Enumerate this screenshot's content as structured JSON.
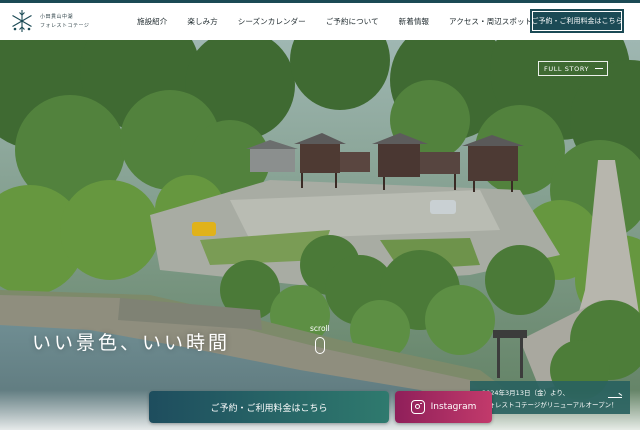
{
  "header": {
    "logo_line1": "小田貫山中湖",
    "logo_line2": "フォレストコテージ",
    "nav": [
      {
        "label": "施設紹介"
      },
      {
        "label": "楽しみ方"
      },
      {
        "label": "シーズンカレンダー"
      },
      {
        "label": "ご予約について"
      },
      {
        "label": "新着情報"
      },
      {
        "label": "アクセス・周辺スポット"
      }
    ],
    "cta_label": "ご予約・ご利用料金はこちら"
  },
  "hero": {
    "full_story_label": "FULL STORY",
    "catchcopy": "いい景色、いい時間",
    "scroll_label": "scroll"
  },
  "news": {
    "line1": "2024年3月13日（金）より、",
    "line2": "フォレストコテージがリニューアルオープン！"
  },
  "bottom_bar": {
    "reserve_label": "ご予約・ご利用料金はこちら",
    "instagram_label": "Instagram"
  },
  "colors": {
    "brand": "#1b4a55",
    "instagram": "#b0306a",
    "news_bg": "#296260"
  }
}
